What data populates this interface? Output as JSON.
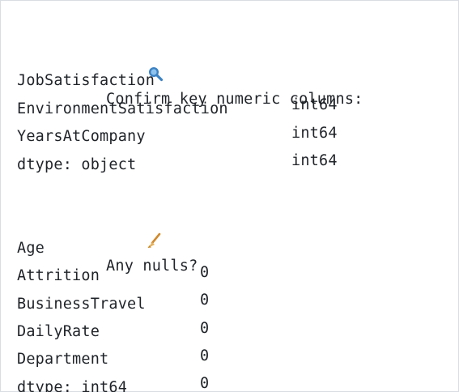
{
  "section1": {
    "icon": "magnifier-icon",
    "heading": "Confirm key numeric columns:",
    "rows": [
      {
        "name": "JobSatisfaction",
        "value": "int64"
      },
      {
        "name": "EnvironmentSatisfaction",
        "value": "int64"
      },
      {
        "name": "YearsAtCompany",
        "value": "int64"
      }
    ],
    "dtype": "dtype: object"
  },
  "section2": {
    "icon": "broom-icon",
    "heading": "Any nulls?",
    "rows": [
      {
        "name": "Age",
        "value": "0"
      },
      {
        "name": "Attrition",
        "value": "0"
      },
      {
        "name": "BusinessTravel",
        "value": "0"
      },
      {
        "name": "DailyRate",
        "value": "0"
      },
      {
        "name": "Department",
        "value": "0"
      }
    ],
    "dtype": "dtype: int64"
  },
  "colors": {
    "text": "#1f2328",
    "magnifier_lens": "#3b82c4",
    "broom_handle": "#d08a2e"
  }
}
